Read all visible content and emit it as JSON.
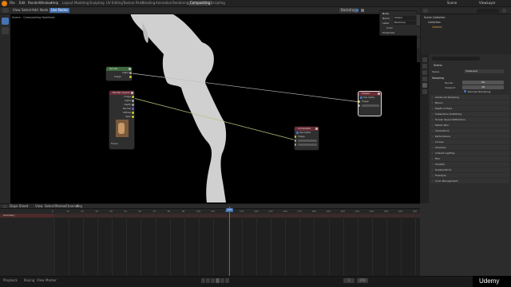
{
  "app": {
    "menus": [
      "File",
      "Edit",
      "Render",
      "Window",
      "Help"
    ],
    "workspace_tabs": [
      "Layout",
      "Modeling",
      "Sculpting",
      "UV Editing",
      "Texture Paint",
      "Shading",
      "Animation",
      "Rendering",
      "Compositing",
      "Scripting"
    ],
    "active_workspace": "Compositing",
    "scene_name": "Scene",
    "view_layer": "ViewLayer"
  },
  "compositor": {
    "header": {
      "editor_menus": [
        "View",
        "Select",
        "Add",
        "Node"
      ],
      "use_nodes_label": "Use Nodes",
      "backdrop_label": "Backdrop"
    },
    "breadcrumb": [
      "Scene",
      "Compositing Nodetree"
    ],
    "nodes": {
      "rgb": {
        "title": "Render",
        "out": "Alpha",
        "out2": "Image",
        "color": "#3d6b3d"
      },
      "render_layers": {
        "title": "Render Layers",
        "outputs": [
          "Image",
          "Alpha",
          "Depth",
          "Normal",
          "Diffuse",
          "Spec"
        ],
        "footer": "Scene",
        "color": "#6b2c36"
      },
      "composite": {
        "title": "Composite",
        "options": [
          "Use Alpha"
        ],
        "inputs": [
          "Image",
          "Alpha",
          "Z"
        ],
        "color": "#6b2c36"
      },
      "viewer": {
        "title": "Viewer",
        "options": [
          "Use Alpha"
        ],
        "inputs": [
          "Image",
          "Alpha"
        ],
        "color": "#6b2c36"
      }
    },
    "sidebar": {
      "tabs": [
        "Node",
        "Tool",
        "View",
        "Options"
      ],
      "section": "Node",
      "name_label": "Name",
      "name_value": "Viewer",
      "label_label": "Label",
      "label_value": "Backdrop",
      "color_label": "Color",
      "properties_label": "Properties"
    }
  },
  "outliner": {
    "title": "Scene Collection",
    "items": [
      "Scene Collection",
      "Collection",
      "Camera"
    ]
  },
  "properties": {
    "search_placeholder": "",
    "context": "Scene",
    "scene_label": "Scene",
    "view_layer_label": "ViewLayer",
    "panel": "Sampling",
    "fields": [
      {
        "label": "Render",
        "value": "64"
      },
      {
        "label": "Viewport",
        "value": "16"
      }
    ],
    "checkbox": "Denoise Rendering",
    "sections": [
      "Advanced Sampling",
      "Bloom",
      "Depth of Field",
      "Subsurface Scattering",
      "Screen Space Reflections",
      "Motion Blur",
      "Volumetrics",
      "Performance",
      "Curves",
      "Shadows",
      "Indirect Lighting",
      "Film",
      "Simplify",
      "Grease Pencil",
      "Freestyle",
      "Color Management"
    ]
  },
  "timeline": {
    "menus": [
      "Dope Sheet",
      "View",
      "Select",
      "Marker",
      "Channel",
      "Key"
    ],
    "mode": "Summary",
    "current_frame": "125",
    "ticks": [
      "0",
      "10",
      "20",
      "30",
      "40",
      "50",
      "60",
      "70",
      "80",
      "90",
      "100",
      "110",
      "120",
      "130",
      "140",
      "150",
      "160",
      "170",
      "180",
      "190",
      "200",
      "210",
      "220",
      "230",
      "240",
      "250"
    ],
    "start": "1",
    "end": "250",
    "channel": "Summary"
  },
  "statusbar": {
    "left": [
      "Playback",
      "Keying",
      "View",
      "Marker"
    ],
    "right_text": "Scene Collection | Verts 0 | 2.92.0",
    "brand": "Udemy"
  }
}
